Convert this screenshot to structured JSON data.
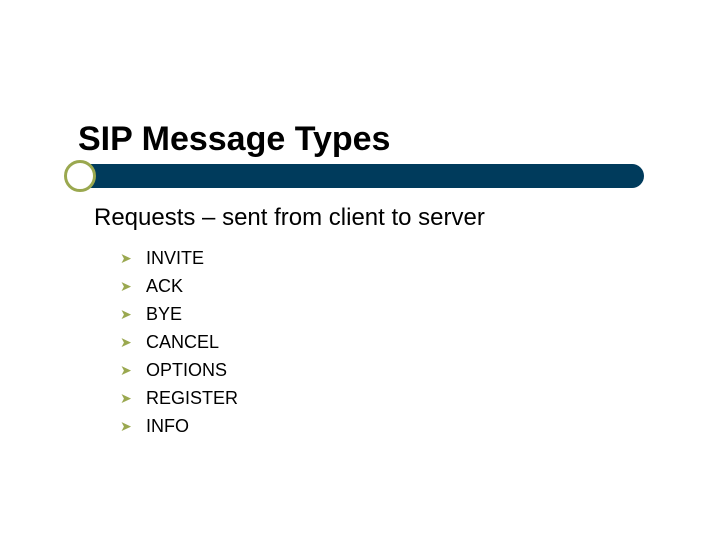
{
  "title": "SIP Message Types",
  "subtitle": "Requests – sent from client to server",
  "bullets": [
    "INVITE",
    "ACK",
    "BYE",
    "CANCEL",
    "OPTIONS",
    "REGISTER",
    "INFO"
  ],
  "colors": {
    "bar": "#003b5c",
    "accent": "#9aa84f"
  }
}
